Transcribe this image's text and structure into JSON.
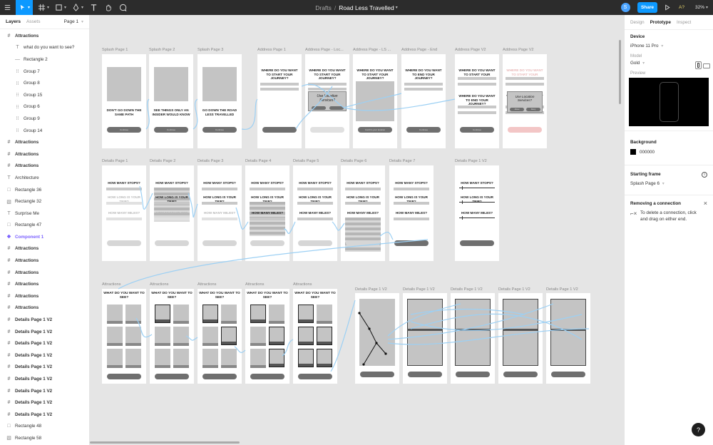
{
  "topbar": {
    "breadcrumb_parent": "Drafts",
    "separator": "/",
    "file_name": "Road Less Travelled",
    "share_label": "Share",
    "avatar_initial": "S",
    "zoom_level": "32%",
    "a_label": "A?",
    "colors": {
      "bg": "#2c2c2c",
      "accent": "#0d99ff"
    }
  },
  "left_panel": {
    "tabs": [
      "Layers",
      "Assets"
    ],
    "page_selector": "Page 1",
    "layers": [
      {
        "name": "Attractions",
        "icon": "frame-icon",
        "indent": 0,
        "bold": true
      },
      {
        "name": "what do you want to see?",
        "icon": "text-icon",
        "indent": 1
      },
      {
        "name": "Rectangle 2",
        "icon": "line-icon",
        "indent": 1
      },
      {
        "name": "Group 7",
        "icon": "group-icon",
        "indent": 1
      },
      {
        "name": "Group 8",
        "icon": "group-icon",
        "indent": 1
      },
      {
        "name": "Group 15",
        "icon": "group-icon",
        "indent": 1
      },
      {
        "name": "Group 6",
        "icon": "group-icon",
        "indent": 1
      },
      {
        "name": "Group 9",
        "icon": "group-icon",
        "indent": 1
      },
      {
        "name": "Group 14",
        "icon": "group-icon",
        "indent": 1
      },
      {
        "name": "Attractions",
        "icon": "frame-icon",
        "indent": 0,
        "bold": true
      },
      {
        "name": "Attractions",
        "icon": "frame-icon",
        "indent": 0,
        "bold": true
      },
      {
        "name": "Attractions",
        "icon": "frame-icon",
        "indent": 0,
        "bold": true
      },
      {
        "name": "Architecture",
        "icon": "text-icon",
        "indent": 0
      },
      {
        "name": "Rectangle 36",
        "icon": "rectangle-icon",
        "indent": 0
      },
      {
        "name": "Rectangle 32",
        "icon": "image-icon",
        "indent": 0
      },
      {
        "name": "Surprise Me",
        "icon": "text-icon",
        "indent": 0
      },
      {
        "name": "Rectangle 47",
        "icon": "rectangle-icon",
        "indent": 0
      },
      {
        "name": "Component 1",
        "icon": "component-icon",
        "indent": 0,
        "component": true
      },
      {
        "name": "Attractions",
        "icon": "frame-icon",
        "indent": 0,
        "bold": true
      },
      {
        "name": "Attractions",
        "icon": "frame-icon",
        "indent": 0,
        "bold": true
      },
      {
        "name": "Attractions",
        "icon": "frame-icon",
        "indent": 0,
        "bold": true
      },
      {
        "name": "Attractions",
        "icon": "frame-icon",
        "indent": 0,
        "bold": true
      },
      {
        "name": "Attractions",
        "icon": "frame-icon",
        "indent": 0,
        "bold": true
      },
      {
        "name": "Attractions",
        "icon": "frame-icon",
        "indent": 0,
        "bold": true
      },
      {
        "name": "Details Page 1 V2",
        "icon": "frame-icon",
        "indent": 0,
        "bold": true
      },
      {
        "name": "Details Page 1 V2",
        "icon": "frame-icon",
        "indent": 0,
        "bold": true
      },
      {
        "name": "Details Page 1 V2",
        "icon": "frame-icon",
        "indent": 0,
        "bold": true
      },
      {
        "name": "Details Page 1 V2",
        "icon": "frame-icon",
        "indent": 0,
        "bold": true
      },
      {
        "name": "Details Page 1 V2",
        "icon": "frame-icon",
        "indent": 0,
        "bold": true
      },
      {
        "name": "Details Page 1 V2",
        "icon": "frame-icon",
        "indent": 0,
        "bold": true
      },
      {
        "name": "Details Page 1 V2",
        "icon": "frame-icon",
        "indent": 0,
        "bold": true
      },
      {
        "name": "Details Page 1 V2",
        "icon": "frame-icon",
        "indent": 0,
        "bold": true
      },
      {
        "name": "Details Page 1 V2",
        "icon": "frame-icon",
        "indent": 0,
        "bold": true
      },
      {
        "name": "Rectangle 48",
        "icon": "rectangle-icon",
        "indent": 0
      },
      {
        "name": "Rectangle 58",
        "icon": "image-icon",
        "indent": 0
      },
      {
        "name": "Details Page 1 V2",
        "icon": "frame-icon",
        "indent": 0,
        "bold": true
      }
    ]
  },
  "right_panel": {
    "tabs": [
      "Design",
      "Prototype",
      "Inspect"
    ],
    "active_tab": "Prototype",
    "device_heading": "Device",
    "device_value": "iPhone 11 Pro",
    "model_label": "Model",
    "model_value": "Gold",
    "preview_label": "Preview",
    "background_heading": "Background",
    "background_value": "000000",
    "starting_frame_heading": "Starting frame",
    "starting_frame_value": "Splash Page 6",
    "removing_heading": "Removing a connection",
    "removing_text": "To delete a connection, click and drag on either end.",
    "help_label": "?"
  },
  "canvas": {
    "row1": [
      {
        "label": "Splash Page 1",
        "kind": "splash",
        "text": "DON'T GO DOWN THE SAME PATH",
        "btn": "Continue"
      },
      {
        "label": "Splash Page 2",
        "kind": "splash",
        "text": "SEE THINGS ONLY AN INSIDER WOULD KNOW",
        "btn": "Continue"
      },
      {
        "label": "Splash Page 3",
        "kind": "splash",
        "text": "GO DOWN THE ROAD LESS TRAVELLED",
        "btn": "Continue"
      },
      {
        "label": "Address Page 1",
        "kind": "address",
        "text": "WHERE DO YOU WANT TO START YOUR JOURNEY?"
      },
      {
        "label": "Address Page - Loc...",
        "kind": "address-loc",
        "text": "WHERE DO YOU WANT TO START YOUR JOURNEY?",
        "dialog": "Use Location Services?"
      },
      {
        "label": "Address Page - LS ...",
        "kind": "address-map",
        "text": "WHERE DO YOU WANT TO START YOUR JOURNEY?",
        "btn": "Confirm your location"
      },
      {
        "label": "Address Page - End",
        "kind": "address-end",
        "text": "WHERE DO YOU WANT TO END YOUR JOURNEY?",
        "btn": "Continue"
      },
      {
        "label": "Address Page V2",
        "kind": "address-v2",
        "text": "WHERE DO YOU WANT TO START YOUR JOURNEY?",
        "text2": "WHERE DO YOU WANT TO END YOUR JOURNEY?",
        "btn": "Continue"
      },
      {
        "label": "Address Page V2",
        "kind": "address-v2-loc",
        "text": "WHERE DO YOU WANT TO START YOUR JOURNEY?",
        "text2": "WHERE DO YOU WANT TO END YOUR JOURNEY?",
        "dialog": "Use Location Services?",
        "allow": "Allow",
        "deny": "Deny"
      }
    ],
    "row2": [
      {
        "label": "Details Page 1",
        "stripes": []
      },
      {
        "label": "Details Page 2",
        "stripes": [
          1
        ]
      },
      {
        "label": "Details Page 3",
        "stripes": []
      },
      {
        "label": "Details Page 4",
        "stripes": [
          2
        ]
      },
      {
        "label": "Details Page 5",
        "stripes": []
      },
      {
        "label": "Details Page 6",
        "stripes": [
          3
        ]
      },
      {
        "label": "Details Page 7",
        "stripes": []
      },
      {
        "label": "Details Page 1 V2",
        "stripes": [],
        "v2": true
      }
    ],
    "details_q": [
      "HOW MANY STOPS?",
      "HOW LONG IS YOUR TRIP?",
      "HOW MANY MILES?"
    ],
    "row3": [
      {
        "label": "Attractions",
        "selected": []
      },
      {
        "label": "Attractions",
        "selected": [
          0
        ]
      },
      {
        "label": "Attractions",
        "selected": [
          0,
          3
        ]
      },
      {
        "label": "Attractions",
        "selected": [
          0,
          3,
          5
        ]
      },
      {
        "label": "Attractions",
        "selected": [
          0,
          2,
          3,
          4,
          5
        ]
      }
    ],
    "attractions_q": "WHAT DO YOU WANT TO SEE?",
    "row3b_labels": [
      "Details Page 1 V2",
      "Details Page 1 V2",
      "Details Page 1 V2",
      "Details Page 1 V2",
      "Details Page 1 V2"
    ]
  }
}
